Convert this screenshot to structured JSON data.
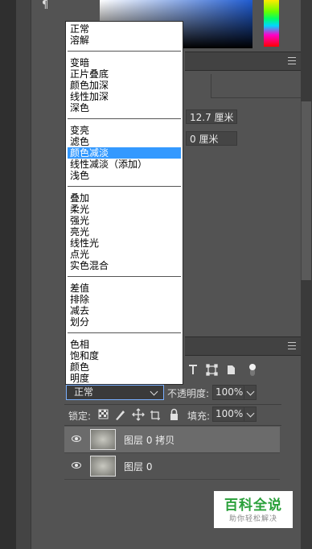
{
  "toolbar": {
    "paragraph_icon": "¶"
  },
  "properties": {
    "width_value": "12.7 厘米",
    "offset_value": "0 厘米"
  },
  "blend_menu": {
    "groups": [
      [
        "正常",
        "溶解"
      ],
      [
        "变暗",
        "正片叠底",
        "颜色加深",
        "线性加深",
        "深色"
      ],
      [
        "变亮",
        "滤色",
        "颜色减淡",
        "线性减淡（添加）",
        "浅色"
      ],
      [
        "叠加",
        "柔光",
        "强光",
        "亮光",
        "线性光",
        "点光",
        "实色混合"
      ],
      [
        "差值",
        "排除",
        "减去",
        "划分"
      ],
      [
        "色相",
        "饱和度",
        "颜色",
        "明度"
      ]
    ],
    "highlighted": "颜色减淡"
  },
  "layers": {
    "blend_mode": "正常",
    "opacity_label": "不透明度:",
    "opacity_value": "100%",
    "lock_label": "锁定:",
    "fill_label": "填充:",
    "fill_value": "100%",
    "items": [
      {
        "name": "图层 0 拷贝",
        "active": true
      },
      {
        "name": "图层 0",
        "active": false
      }
    ]
  },
  "watermark": {
    "title": "百科全说",
    "subtitle": "助你轻松解决"
  },
  "colors": {
    "highlight": "#3399ff",
    "panel_bg": "#535353",
    "watermark_green": "#2aa03a"
  }
}
